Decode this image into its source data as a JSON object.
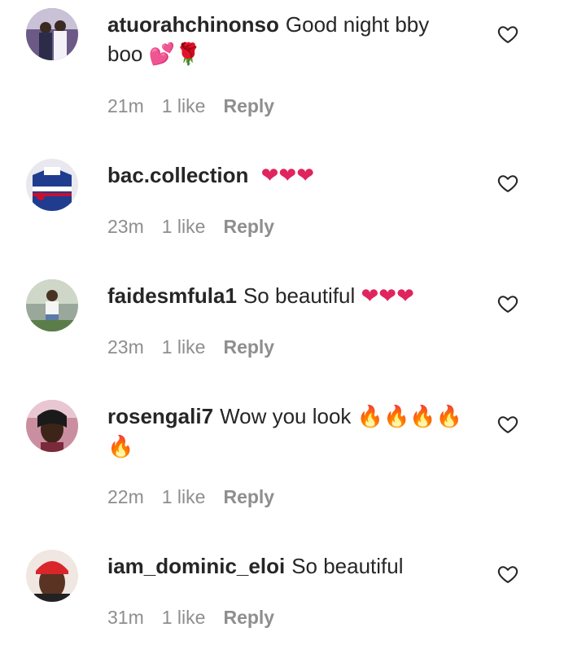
{
  "comments": [
    {
      "username": "atuorahchinonso",
      "text": "Good night bby boo",
      "emojis": "💕🌹",
      "time": "21m",
      "likes": "1 like",
      "reply_label": "Reply"
    },
    {
      "username": "bac.collection",
      "text": "",
      "emojis": "❤❤❤",
      "time": "23m",
      "likes": "1 like",
      "reply_label": "Reply"
    },
    {
      "username": "faidesmfula1",
      "text": "So beautiful",
      "emojis": "❤❤❤",
      "time": "23m",
      "likes": "1 like",
      "reply_label": "Reply"
    },
    {
      "username": "rosengali7",
      "text": "Wow you look",
      "emojis": "🔥🔥🔥🔥🔥",
      "time": "22m",
      "likes": "1 like",
      "reply_label": "Reply"
    },
    {
      "username": "iam_dominic_eloi",
      "text": "So beautiful",
      "emojis": "",
      "time": "31m",
      "likes": "1 like",
      "reply_label": "Reply"
    }
  ],
  "icons": {
    "like": "heart-outline-icon"
  },
  "colors": {
    "text": "#262626",
    "meta": "#8e8e8e",
    "heart_emoji": "#e0245e",
    "fire_emoji": "#f26b1d"
  }
}
